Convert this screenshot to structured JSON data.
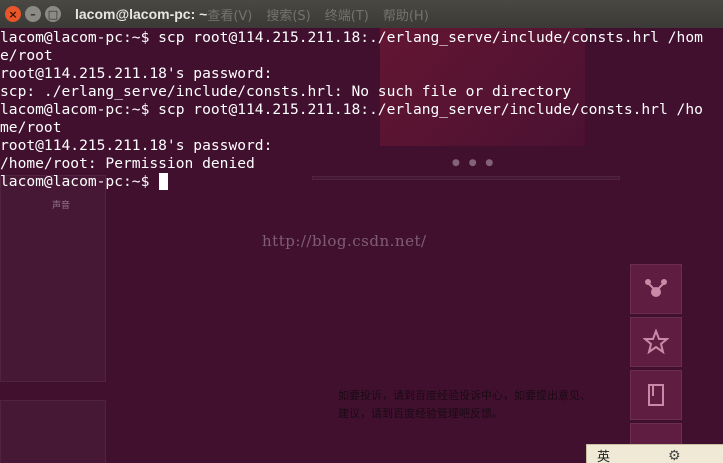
{
  "window": {
    "title": "lacom@lacom-pc: ~",
    "menu": [
      "查看(V)",
      "搜索(S)",
      "终端(T)",
      "帮助(H)"
    ],
    "controls": {
      "close": "×",
      "minimize": "–",
      "maximize": "□"
    }
  },
  "terminal": {
    "lines": [
      "lacom@lacom-pc:~$ scp root@114.215.211.18:./erlang_serve/include/consts.hrl /hom",
      "e/root",
      "root@114.215.211.18's password:",
      "scp: ./erlang_serve/include/consts.hrl: No such file or directory",
      "lacom@lacom-pc:~$ scp root@114.215.211.18:./erlang_server/include/consts.hrl /ho",
      "me/root",
      "root@114.215.211.18's password:",
      "/home/root: Permission denied",
      "lacom@lacom-pc:~$ "
    ]
  },
  "background": {
    "watermark": "http://blog.csdn.net/",
    "notice": "如要投诉，请到百度经验投诉中心，如要提出意见、建议，请到百度经验管理吧反馈。",
    "label": "声音",
    "dots": "● ● ●",
    "ime": {
      "label": "英",
      "gear": "⚙"
    },
    "side_buttons": [
      {
        "icon": "share-icon"
      },
      {
        "icon": "star-icon"
      },
      {
        "icon": "bookmark-icon"
      }
    ]
  }
}
